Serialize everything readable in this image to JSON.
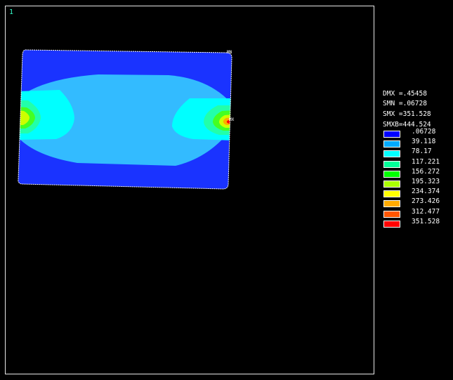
{
  "window": {
    "number": "1"
  },
  "info": {
    "hidden_lines": [
      "",
      "",
      "",
      "",
      "",
      "",
      "",
      ""
    ],
    "lines": [
      "DMX =.45458",
      "SMN =.06728",
      "SMX =351.528",
      "SMXB=444.524"
    ]
  },
  "tags": {
    "min": "MN",
    "max": "MX"
  },
  "legend": [
    {
      "value": ".06728",
      "color": "#0000ff"
    },
    {
      "value": "39.118",
      "color": "#00aaff"
    },
    {
      "value": "78.17",
      "color": "#00ffff"
    },
    {
      "value": "117.221",
      "color": "#00ff99"
    },
    {
      "value": "156.272",
      "color": "#00ff00"
    },
    {
      "value": "195.323",
      "color": "#aaff00"
    },
    {
      "value": "234.374",
      "color": "#ffff00"
    },
    {
      "value": "273.426",
      "color": "#ffaa00"
    },
    {
      "value": "312.477",
      "color": "#ff5500"
    },
    {
      "value": "351.528",
      "color": "#ff0000"
    }
  ],
  "contour_colors": {
    "base": "#1a33ff",
    "band2": "#33bbff",
    "band3": "#00ffff",
    "band4": "#22ffaa",
    "band5": "#44ff22",
    "band6": "#ccff00",
    "band7": "#ffaa00",
    "band8": "#ff0000"
  }
}
